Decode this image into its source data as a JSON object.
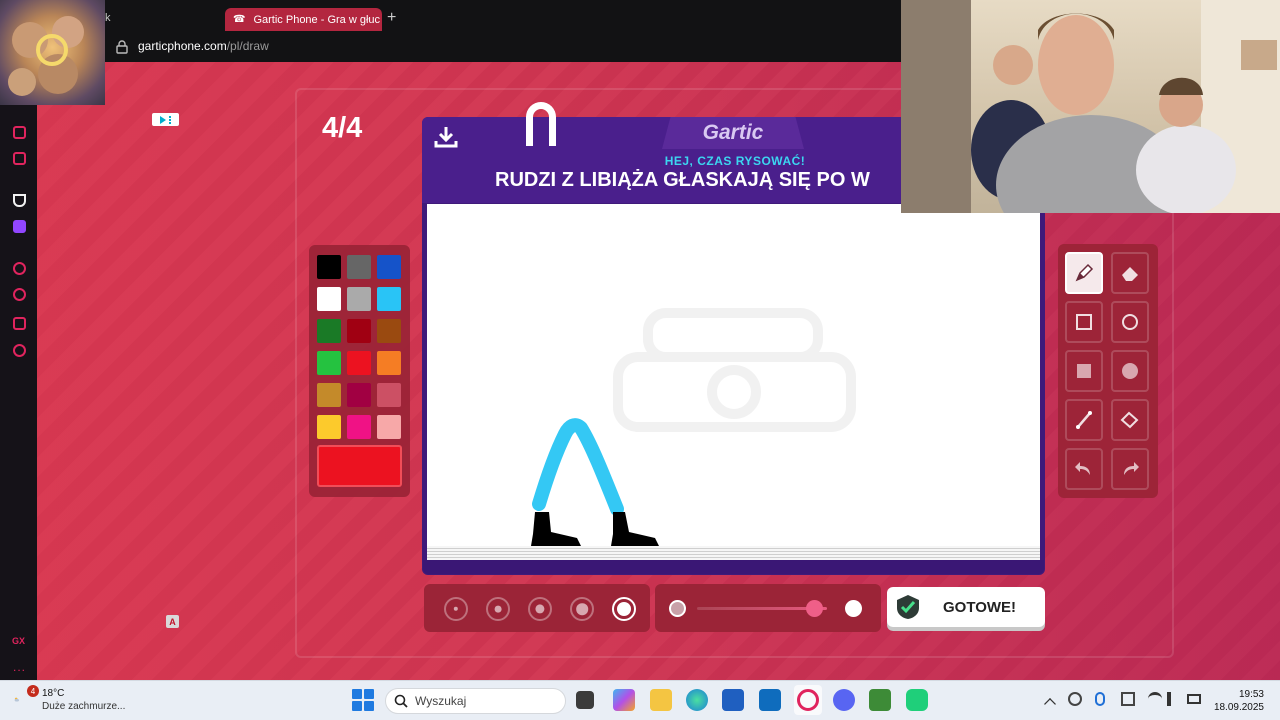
{
  "browser": {
    "prev_tab_fragment": "k",
    "tab_title": "Gartic Phone - Gra w głuc",
    "tab_icon": "☎",
    "new_tab": "+",
    "url_host": "garticphone.com",
    "url_path": "/pl/draw"
  },
  "sidebar": {
    "gx_label": "GX",
    "more_label": "..."
  },
  "game": {
    "round": "4/4",
    "logo": "Gartic",
    "prompt_header": "HEJ, CZAS RYSOWAĆ!",
    "prompt_text": "RUDZI Z LIBIĄŻA GŁASKAJĄ SIĘ PO W",
    "done_label": "GOTOWE!",
    "ab_icon_label": "A",
    "palette": {
      "colors": [
        "#000000",
        "#666666",
        "#1553c9",
        "#ffffff",
        "#aaaaaa",
        "#29c4f6",
        "#1a7a26",
        "#a00012",
        "#9a4a10",
        "#25c240",
        "#ec1220",
        "#f57d24",
        "#c48a2a",
        "#a10042",
        "#cc5064",
        "#fcca2c",
        "#f01285",
        "#f7a8a8"
      ],
      "current": "#ec1220"
    },
    "brush_sizes": [
      1,
      2,
      3,
      4,
      5
    ],
    "selected_size": 5,
    "opacity": 0.9,
    "tools": [
      "pencil-icon",
      "eraser-icon",
      "rectangle-outline-icon",
      "ellipse-outline-icon",
      "rectangle-filled-icon",
      "ellipse-filled-icon",
      "line-icon",
      "fill-bucket-icon",
      "undo-icon",
      "redo-icon"
    ],
    "active_tool": "pencil-icon",
    "drawing_colors": {
      "legs": "#34c8f4",
      "shoes": "#000000"
    }
  },
  "taskbar": {
    "weather_temp": "18°C",
    "weather_desc": "Duże zachmurze...",
    "notif_count": "4",
    "search_placeholder": "Wyszukaj",
    "time": "19:53",
    "date": "18.09.2025"
  }
}
